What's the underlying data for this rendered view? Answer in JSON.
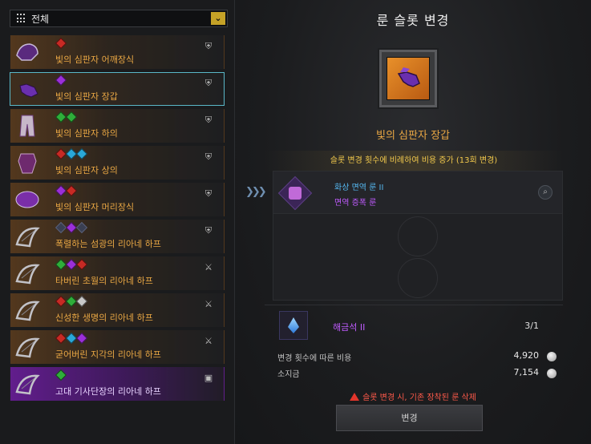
{
  "filter": {
    "label": "전체"
  },
  "items": [
    {
      "name": "빛의 심판자 어깨장식",
      "gems": [
        "red"
      ],
      "style": "normal",
      "thumb": "shoulder-armor-icon",
      "category": "armor-category-icon"
    },
    {
      "name": "빛의 심판자 장갑",
      "gems": [
        "purple"
      ],
      "style": "selected",
      "thumb": "gloves-icon",
      "category": "armor-category-icon"
    },
    {
      "name": "빛의 심판자 하의",
      "gems": [
        "green",
        "green"
      ],
      "style": "normal",
      "thumb": "pants-icon",
      "category": "armor-category-icon"
    },
    {
      "name": "빛의 심판자 상의",
      "gems": [
        "red",
        "cyan",
        "cyan"
      ],
      "style": "normal",
      "thumb": "chest-armor-icon",
      "category": "armor-category-icon"
    },
    {
      "name": "빛의 심판자 머리장식",
      "gems": [
        "purple",
        "red"
      ],
      "style": "normal",
      "thumb": "helmet-icon",
      "category": "armor-category-icon"
    },
    {
      "name": "폭렬하는 섬광의 리아네 하프",
      "gems": [
        "dim",
        "purple",
        "dim"
      ],
      "style": "normal",
      "thumb": "harp-icon",
      "category": "armor-category-icon"
    },
    {
      "name": "타버린 초월의 리아네 하프",
      "gems": [
        "green",
        "purple",
        "red"
      ],
      "style": "normal",
      "thumb": "harp-icon",
      "category": "weapon-category-icon"
    },
    {
      "name": "신성한 생명의 리아네 하프",
      "gems": [
        "red",
        "green",
        "white"
      ],
      "style": "normal",
      "thumb": "harp-icon",
      "category": "weapon-category-icon"
    },
    {
      "name": "굳어버린 지각의 리아네 하프",
      "gems": [
        "red",
        "cyan",
        "purple"
      ],
      "style": "normal",
      "thumb": "harp-icon",
      "category": "weapon-category-icon"
    },
    {
      "name": "고대 기사단장의 리아네 하프",
      "gems": [
        "green"
      ],
      "style": "purple",
      "thumb": "harp-icon",
      "category": "bag-category-icon"
    }
  ],
  "panel": {
    "title": "룬 슬롯 변경",
    "selected_item": "빛의 심판자 장갑",
    "notice": "슬롯 변경 횟수에 비례하여 비용 증가 (13회 변경)",
    "rune": {
      "line1": "화상 면역 룬 II",
      "line2": "면역 증폭 룬"
    },
    "material": {
      "name": "해금석 II",
      "count": "3/1"
    },
    "cost_label": "변경 횟수에 따른 비용",
    "cost_value": "4,920",
    "owned_label": "소지금",
    "owned_value": "7,154",
    "warning": "슬롯 변경 시, 기존 장착된 룬 삭제",
    "button": "변경"
  }
}
